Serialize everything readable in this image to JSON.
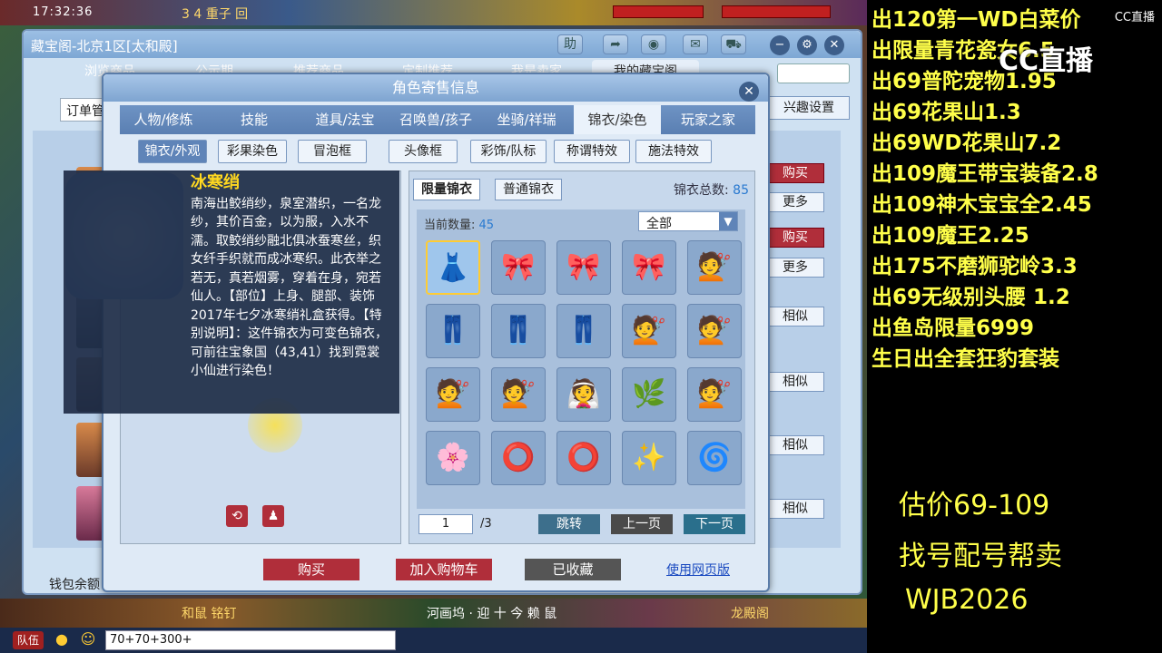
{
  "game": {
    "time": "17:32:36",
    "top_names": "3 4 重子 回",
    "bottom_left": "和鼠 铭钉",
    "bottom_mid": "河画坞 · 迎 十 今 赖 鼠",
    "bottom_right": "龙殿阁",
    "chat_team": "队伍",
    "chat_input": "70+70+300+"
  },
  "window": {
    "title": "藏宝阁-北京1区[太和殿]",
    "help": "助",
    "tabs": [
      "浏览商品",
      "公示期",
      "推荐商品",
      "定制推荐",
      "我是卖家",
      "我的藏宝阁"
    ],
    "order_label": "订单管",
    "interest_label": "兴趣设置",
    "row_buy": "购买",
    "row_more": "更多",
    "row_similar": "相似",
    "wallet": "钱包余额"
  },
  "modal": {
    "title": "角色寄售信息",
    "tabs": [
      "人物/修炼",
      "技能",
      "道具/法宝",
      "召唤兽/孩子",
      "坐骑/祥瑞",
      "锦衣/染色",
      "玩家之家"
    ],
    "subtabs": [
      "锦衣/外观",
      "彩果染色",
      "冒泡框",
      "头像框",
      "彩饰/队标",
      "称谓特效",
      "施法特效"
    ],
    "item": {
      "name": "冰寒绡",
      "desc": "南海出鲛绡纱，泉室潜织，一名龙纱，其价百金，以为服，入水不濡。取鲛绡纱融北俱冰蚕寒丝，织女纤手织就而成冰寒织。此衣举之若无，真若烟雾，穿着在身，宛若仙人。【部位】上身、腿部、装饰 2017年七夕冰寒绡礼盒获得。【特别说明】：这件锦衣为可变色锦衣，可前往宝象国（43,41）找到霓裳小仙进行染色！"
    },
    "rp_tabs": [
      "限量锦衣",
      "普通锦衣"
    ],
    "total_label": "锦衣总数:",
    "total_value": "85",
    "count_label": "当前数量:",
    "count_value": "45",
    "filter": "全部",
    "page": "1",
    "page_total": "/3",
    "jump": "跳转",
    "prev": "上一页",
    "next": "下一页",
    "buy": "购买",
    "cart": "加入购物车",
    "saved": "已收藏",
    "web": "使用网页版"
  },
  "stream": {
    "logo": "CC直播",
    "cc_text": "CC直播",
    "lines": [
      "出120第一WD白菜价",
      "出限量青花瓷女6.5",
      "出69普陀宠物1.95",
      "出69花果山1.3",
      "出69WD花果山7.2",
      "出109魔王带宝装备2.8",
      "出109神木宝宝全2.45",
      "出109魔王2.25",
      "出175不磨狮驼岭3.3",
      "出69无级别头腰 1.2",
      "出鱼岛限量6999",
      "生日出全套狂豹套装"
    ],
    "estimate": "估价69-109",
    "service": "找号配号帮卖",
    "contact": "WJB2026"
  }
}
